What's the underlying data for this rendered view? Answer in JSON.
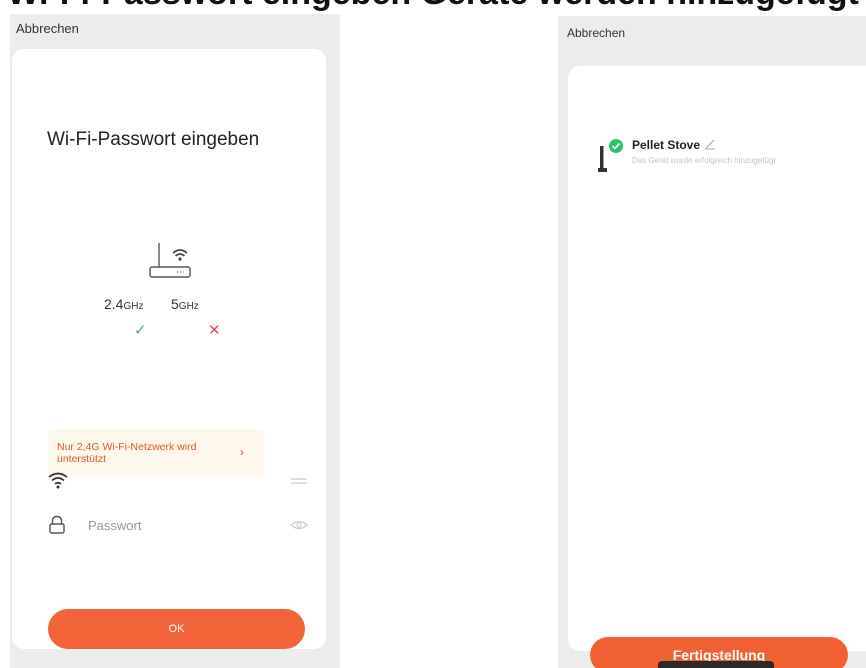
{
  "header_strip": {
    "text": "Wi-Fi-Passwort eingeben                              Geräte werden hinzugefügt"
  },
  "left_screen": {
    "cancel_label": "Abbrechen",
    "title": "Wi-Fi-Passwort eingeben",
    "bands": [
      {
        "freq": "2.4",
        "unit": "GHz",
        "status": "✓",
        "status_color": "#4caf7d"
      },
      {
        "freq": "5",
        "unit": "GHz",
        "status": "✕",
        "status_color": "#e8475b"
      }
    ],
    "warning": {
      "text": "Nur 2,4G Wi-Fi-Netzwerk wird unterstützt",
      "chevron": "›"
    },
    "wifi_field": {
      "value": "",
      "placeholder": ""
    },
    "password_field": {
      "value": "",
      "placeholder": "Passwort"
    },
    "ok_button": "OK",
    "accent": "#f06437"
  },
  "right_screen": {
    "cancel_label": "Abbrechen",
    "device": {
      "name": "Pellet Stove",
      "subtitle": "Das Gerät wurde erfolgreich hinzugefügt",
      "status_icon": "check-circle-icon",
      "status_color": "#27c46b"
    },
    "done_button": "Fertigstellung",
    "accent": "#f26031"
  }
}
